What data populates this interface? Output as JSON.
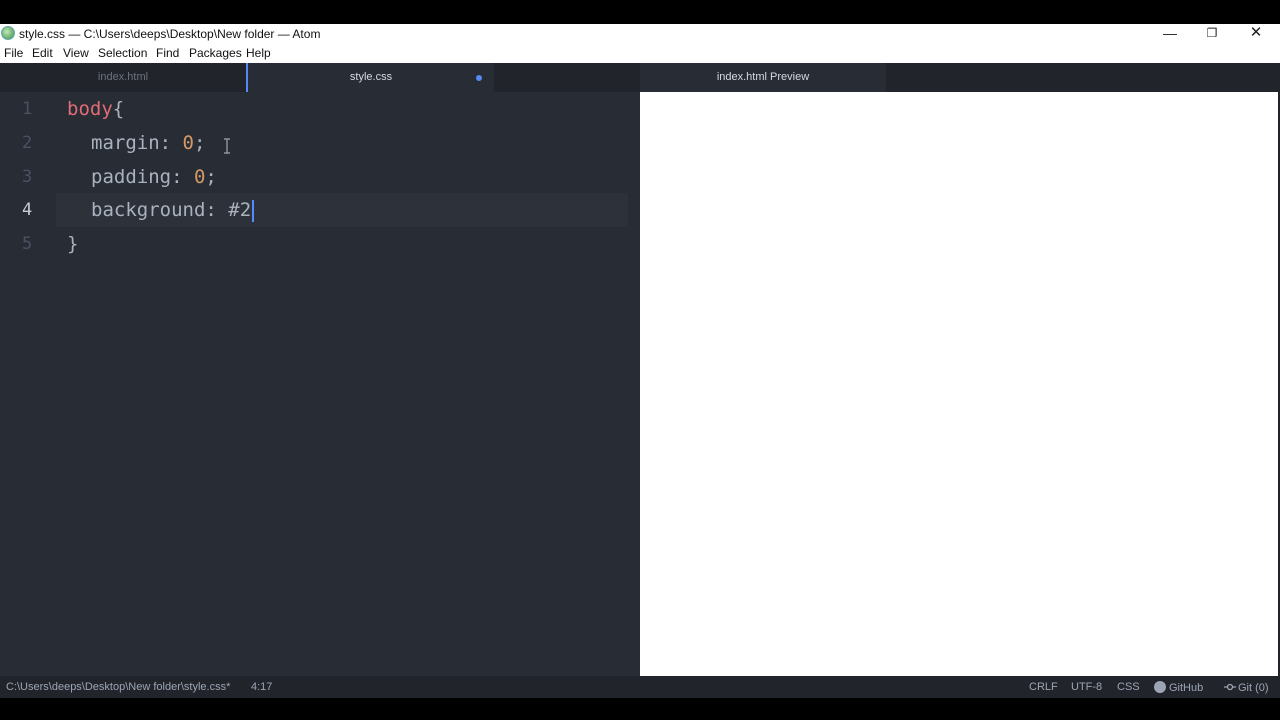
{
  "window": {
    "title": "style.css — C:\\Users\\deeps\\Desktop\\New folder — Atom",
    "controls": {
      "minimize": "—",
      "restore": "❐",
      "close": "✕"
    }
  },
  "menubar": [
    "File",
    "Edit",
    "View",
    "Selection",
    "Find",
    "Packages",
    "Help"
  ],
  "tabs_left": [
    {
      "label": "index.html",
      "active": false
    },
    {
      "label": "style.css",
      "active": true,
      "modified": true
    }
  ],
  "tabs_right": [
    {
      "label": "index.html Preview",
      "active": true
    }
  ],
  "editor": {
    "line_numbers": [
      "1",
      "2",
      "3",
      "4",
      "5"
    ],
    "current_line": 4,
    "lines": [
      {
        "selector": "body",
        "brace": "{"
      },
      {
        "property": "margin",
        "colon": ": ",
        "value": "0",
        "semi": ";"
      },
      {
        "property": "padding",
        "colon": ": ",
        "value": "0",
        "semi": ";"
      },
      {
        "property": "background",
        "colon": ": ",
        "value": "#2"
      },
      {
        "brace": "}"
      }
    ]
  },
  "statusbar": {
    "file_path": "C:\\Users\\deeps\\Desktop\\New folder\\style.css*",
    "cursor_position": "4:17",
    "line_ending": "CRLF",
    "encoding": "UTF-8",
    "grammar": "CSS",
    "github_label": "GitHub",
    "git_label": "Git (0)"
  },
  "colors": {
    "accent": "#568af2",
    "editor_bg": "#282c34",
    "chrome_bg": "#21252b",
    "selector": "#e06c75",
    "number": "#d19a66"
  }
}
